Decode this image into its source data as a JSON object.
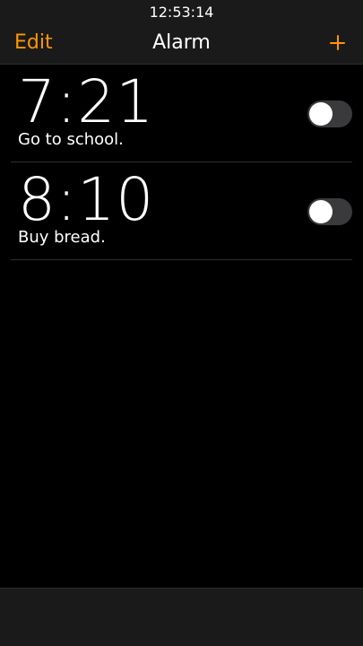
{
  "status_bar": {
    "time": "12:53:14"
  },
  "nav": {
    "edit_label": "Edit",
    "title": "Alarm",
    "add_icon": "plus-icon"
  },
  "alarms": [
    {
      "time": "7:21",
      "label": "Go to school.",
      "enabled": false
    },
    {
      "time": "8:10",
      "label": "Buy bread.",
      "enabled": false
    }
  ],
  "colors": {
    "accent": "#ff9500",
    "background": "#000000",
    "bar_background": "#1a1a1a",
    "toggle_off": "#3a3a3c"
  }
}
